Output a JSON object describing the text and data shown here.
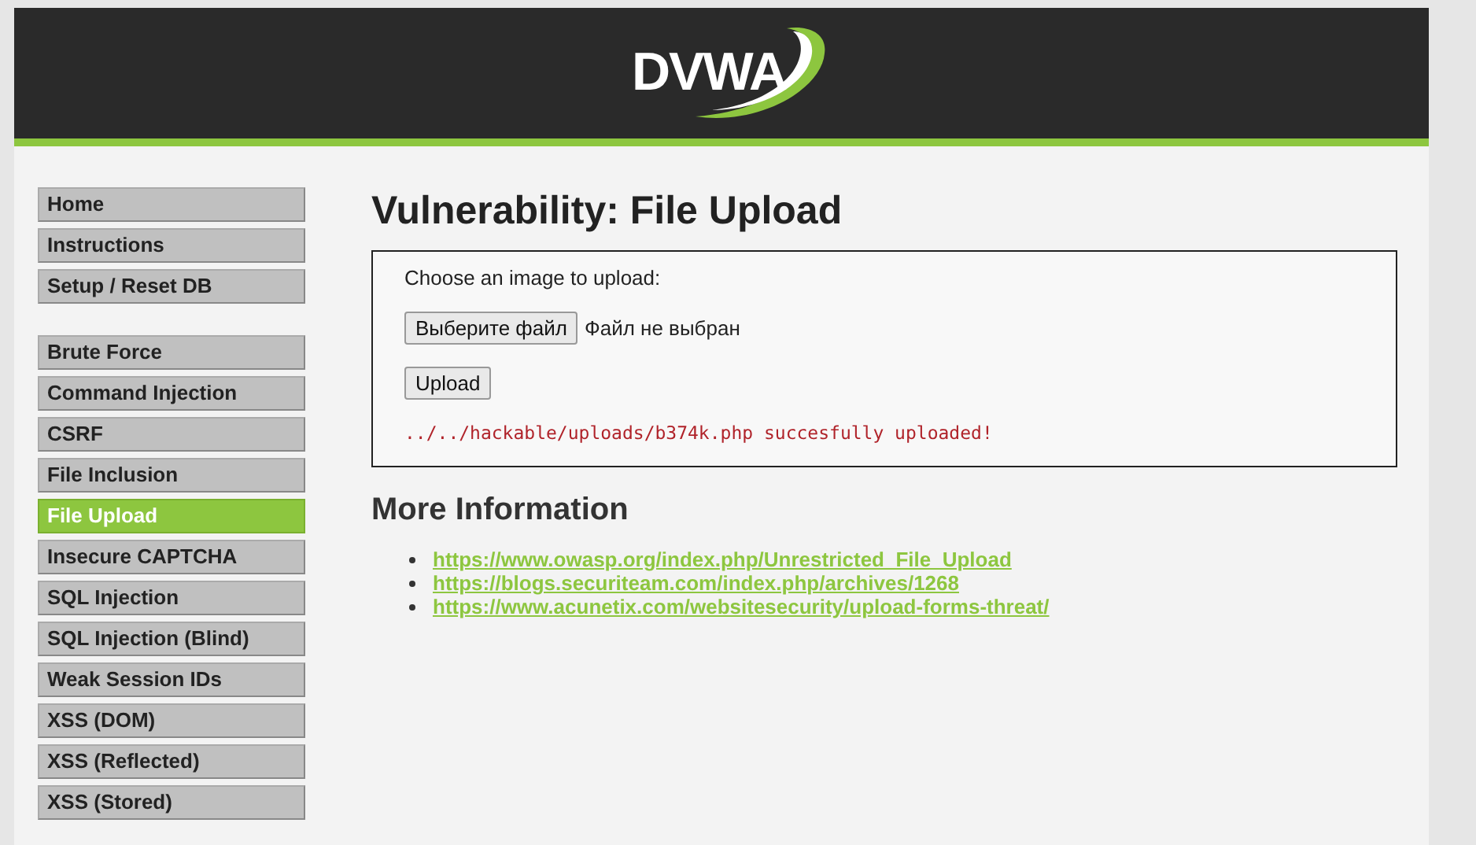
{
  "header": {
    "logo": "DVWA"
  },
  "menu": {
    "groups": [
      [
        {
          "label": "Home",
          "selected": false
        },
        {
          "label": "Instructions",
          "selected": false
        },
        {
          "label": "Setup / Reset DB",
          "selected": false
        }
      ],
      [
        {
          "label": "Brute Force",
          "selected": false
        },
        {
          "label": "Command Injection",
          "selected": false
        },
        {
          "label": "CSRF",
          "selected": false
        },
        {
          "label": "File Inclusion",
          "selected": false
        },
        {
          "label": "File Upload",
          "selected": true
        },
        {
          "label": "Insecure CAPTCHA",
          "selected": false
        },
        {
          "label": "SQL Injection",
          "selected": false
        },
        {
          "label": "SQL Injection (Blind)",
          "selected": false
        },
        {
          "label": "Weak Session IDs",
          "selected": false
        },
        {
          "label": "XSS (DOM)",
          "selected": false
        },
        {
          "label": "XSS (Reflected)",
          "selected": false
        },
        {
          "label": "XSS (Stored)",
          "selected": false
        }
      ]
    ]
  },
  "main": {
    "title": "Vulnerability: File Upload",
    "form": {
      "prompt": "Choose an image to upload:",
      "file_button": "Выберите файл",
      "file_status": "Файл не выбран",
      "upload_button": "Upload",
      "message": "../../hackable/uploads/b374k.php succesfully uploaded!"
    },
    "more_info": {
      "heading": "More Information",
      "links": [
        "https://www.owasp.org/index.php/Unrestricted_File_Upload",
        "https://blogs.securiteam.com/index.php/archives/1268",
        "https://www.acunetix.com/websitesecurity/upload-forms-threat/"
      ]
    }
  }
}
